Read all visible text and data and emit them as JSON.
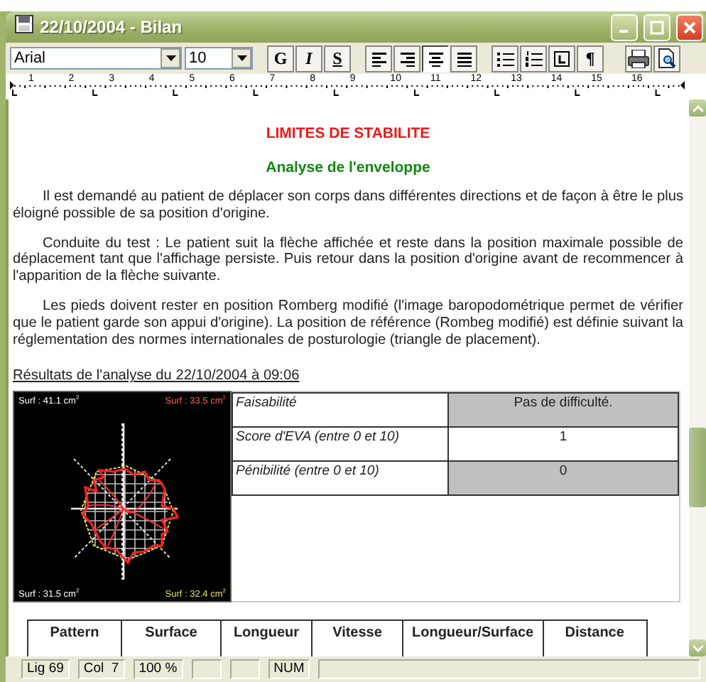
{
  "window": {
    "title": "22/10/2004 - Bilan"
  },
  "toolbar": {
    "font": "Arial",
    "size": "10",
    "format_buttons": [
      {
        "label": "G",
        "kind": "bold"
      },
      {
        "label": "I",
        "kind": "italic"
      },
      {
        "label": "S",
        "kind": "underline"
      }
    ],
    "alignment": [
      {
        "kind": "left",
        "selected": false
      },
      {
        "kind": "right",
        "selected": false
      },
      {
        "kind": "center",
        "selected": true
      },
      {
        "kind": "justify",
        "selected": false
      }
    ],
    "paragraph_buttons": [
      {
        "kind": "bullets"
      },
      {
        "kind": "numbering"
      },
      {
        "kind": "tab"
      },
      {
        "label": "¶",
        "kind": "text"
      }
    ],
    "right_buttons": [
      {
        "kind": "print"
      },
      {
        "kind": "preview"
      }
    ]
  },
  "ruler": {
    "labels": [
      "1",
      "2",
      "3",
      "4",
      "5",
      "6",
      "7",
      "8",
      "9",
      "10",
      "11",
      "12",
      "13",
      "14",
      "15",
      "16"
    ]
  },
  "document": {
    "title": "LIMITES DE STABILITE",
    "subtitle": "Analyse de l'enveloppe",
    "paragraphs": [
      "Il est demandé au patient de déplacer son corps dans différentes directions et de façon à être le plus éloigné possible de sa position d'origine.",
      "Conduite du test : Le patient suit la flèche affichée et reste dans la position maximale possible de déplacement tant que l'affichage persiste. Puis retour dans la position d'origine avant de recommencer à l'apparition de la flèche suivante.",
      "Les pieds doivent rester en position Romberg modifié (l'image baropodométrique permet de vérifier que le patient garde son appui d'origine). La position de référence (Rombeg modifié) est définie suivant la réglementation des normes internationales de posturologie (triangle de placement)."
    ],
    "results_heading": "Résultats de l'analyse du 22/10/2004 à 09:06",
    "plot_labels": [
      {
        "text": "Surf : 41.1 cm$^{2}$",
        "color": "#ffffff"
      },
      {
        "text": "Surf : 33.5 cm$^{2}$",
        "color": "#ff6060"
      },
      {
        "text": "Surf : 31.5 cm$^{2}$",
        "color": "#ffffff"
      },
      {
        "text": "Surf : 32.4 cm$^{2}$",
        "color": "#e0e060"
      }
    ],
    "results": [
      {
        "label": "Faisabilité",
        "value": "Pas de difficulté.",
        "shaded": true
      },
      {
        "label": "Score d'EVA (entre 0 et 10)",
        "value": "1",
        "shaded": false
      },
      {
        "label": "Pénibilité (entre 0 et 10)",
        "value": "0",
        "shaded": true
      }
    ],
    "table": {
      "columns": [
        "Pattern",
        "Surface",
        "Longueur",
        "Vitesse",
        "Longueur/Surface",
        "Distance"
      ]
    }
  },
  "status_bar": [
    {
      "kind": "text",
      "text": "Lig 69"
    },
    {
      "kind": "text",
      "text": "Col  7"
    },
    {
      "kind": "text",
      "text": "100 %"
    },
    {
      "kind": "empty"
    },
    {
      "kind": "empty"
    },
    {
      "kind": "text",
      "text": "NUM"
    },
    {
      "kind": "fill"
    }
  ]
}
